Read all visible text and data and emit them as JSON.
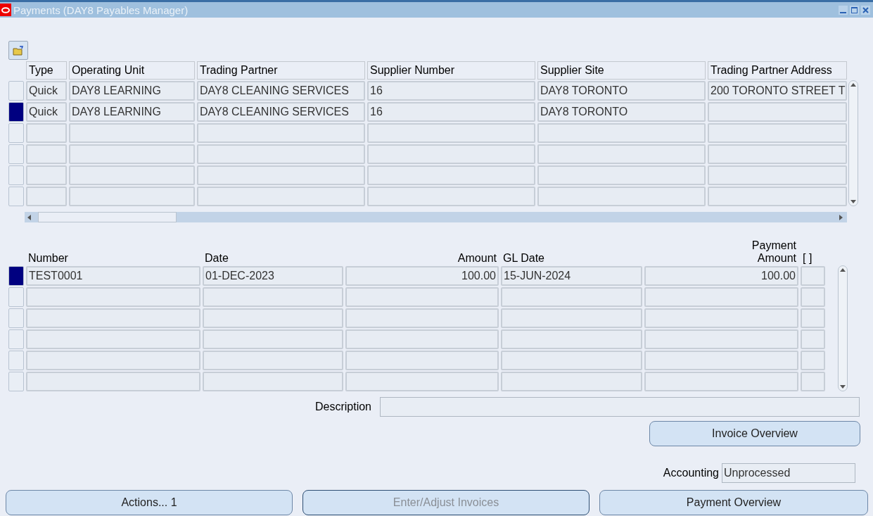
{
  "window": {
    "title": "Payments (DAY8 Payables Manager)"
  },
  "payments_table": {
    "columns": [
      {
        "label": "Type",
        "numeric": false
      },
      {
        "label": "Operating Unit",
        "numeric": false
      },
      {
        "label": "Trading Partner",
        "numeric": false
      },
      {
        "label": "Supplier Number",
        "numeric": false
      },
      {
        "label": "Supplier Site",
        "numeric": false
      },
      {
        "label": "Trading Partner Address",
        "numeric": false
      }
    ],
    "rows": [
      {
        "selected": false,
        "cells": [
          "Quick",
          "DAY8 LEARNING",
          "DAY8 CLEANING SERVICES",
          "16",
          "DAY8 TORONTO",
          "200 TORONTO STREET  T"
        ]
      },
      {
        "selected": true,
        "cells": [
          "Quick",
          "DAY8 LEARNING",
          "DAY8 CLEANING SERVICES",
          "16",
          "DAY8 TORONTO"
        ]
      },
      {
        "selected": false
      },
      {
        "selected": false
      },
      {
        "selected": false
      },
      {
        "selected": false
      }
    ]
  },
  "invoices_table": {
    "columns": [
      {
        "label": "Number",
        "numeric": false
      },
      {
        "label": "Date",
        "numeric": false
      },
      {
        "label": "Amount",
        "numeric": true
      },
      {
        "label": "GL Date",
        "numeric": false
      },
      {
        "label": "Payment Amount",
        "numeric": true
      },
      {
        "label": "[ ]",
        "numeric": false
      }
    ],
    "rows": [
      {
        "selected": true,
        "cells": [
          "TEST0001",
          "01-DEC-2023",
          "100.00",
          "15-JUN-2024",
          "100.00"
        ]
      },
      {
        "selected": false
      },
      {
        "selected": false
      },
      {
        "selected": false
      },
      {
        "selected": false
      },
      {
        "selected": false
      }
    ]
  },
  "description": {
    "label": "Description"
  },
  "invoice_overview_button": {
    "label": "Invoice Overview"
  },
  "accounting": {
    "label": "Accounting",
    "value": "Unprocessed"
  },
  "buttons": [
    {
      "label": "Actions... 1",
      "disabled": false
    },
    {
      "label": "Enter/Adjust Invoices",
      "disabled": true
    },
    {
      "label": "Payment Overview",
      "disabled": false
    }
  ]
}
